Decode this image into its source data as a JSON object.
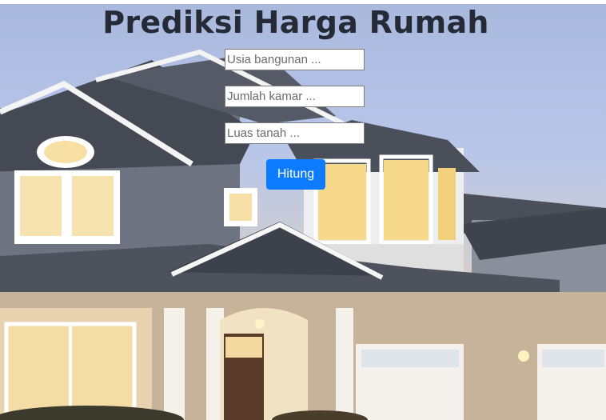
{
  "page": {
    "title": "Prediksi Harga Rumah"
  },
  "form": {
    "usia_placeholder": "Usia bangunan ...",
    "kamar_placeholder": "Jumlah kamar ...",
    "luas_placeholder": "Luas tanah ...",
    "submit_label": "Hitung"
  },
  "colors": {
    "button": "#0d7bff",
    "title": "#242a36"
  }
}
